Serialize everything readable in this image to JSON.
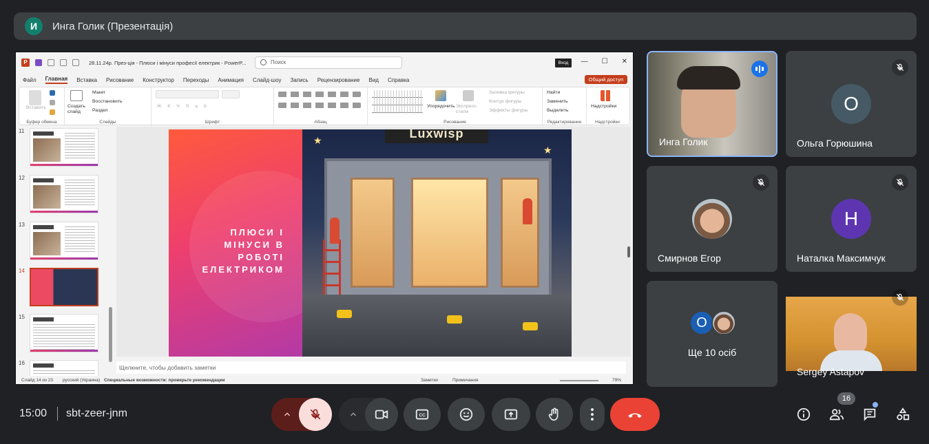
{
  "presenter_bar": {
    "avatar_letter": "И",
    "title": "Инга Голик (Презентація)"
  },
  "powerpoint": {
    "file_title": "28.11.24р. През-ція - Плюси і мінуси професії електрик - PowerP...",
    "search_placeholder": "Поиск",
    "login_label": "Вход",
    "share_label": "Общий доступ",
    "tabs": [
      "Файл",
      "Главная",
      "Вставка",
      "Рисование",
      "Конструктор",
      "Переходы",
      "Анимация",
      "Слайд-шоу",
      "Запись",
      "Рецензирование",
      "Вид",
      "Справка"
    ],
    "active_tab": "Главная",
    "ribbon": {
      "paste": "Вставить",
      "clipboard_group": "Буфер обмена",
      "new_slide": "Создать слайд",
      "layout": "Макет",
      "reset": "Восстановить",
      "section": "Раздел",
      "slides_group": "Слайды",
      "font_group": "Шрифт",
      "paragraph_group": "Абзац",
      "arrange": "Упорядочить",
      "quick_styles": "Экспресс-стили",
      "shape_fill": "Заливка фигуры",
      "shape_outline": "Контур фигуры",
      "shape_effects": "Эффекты фигуры",
      "drawing_group": "Рисование",
      "find": "Найти",
      "replace": "Заменить",
      "select": "Выделить",
      "editing_group": "Редактирование",
      "addins": "Надстройки",
      "addins_group": "Надстройки"
    },
    "slide_numbers": [
      "11",
      "12",
      "13",
      "14",
      "15",
      "16"
    ],
    "selected_slide": "14",
    "slide": {
      "headline": "ПЛЮСИ І МІНУСИ В РОБОТІ ЕЛЕКТРИКОМ",
      "sign_text": "Luxwisp"
    },
    "notes_placeholder": "Щелкните, чтобы добавить заметки",
    "status": {
      "slide_count": "Слайд 14 из 23",
      "language": "русский (Украина)",
      "accessibility": "Специальные возможности: проверьте рекомендации",
      "notes": "Заметки",
      "comments": "Примечания",
      "zoom": "79%"
    }
  },
  "participants": [
    {
      "name": "Инга Голик",
      "type": "video",
      "speaking": true
    },
    {
      "name": "Ольга Горюшина",
      "type": "letter",
      "letter": "О",
      "color": "#455a64",
      "muted": true
    },
    {
      "name": "Смирнов Егор",
      "type": "photo",
      "muted": true
    },
    {
      "name": "Наталка Максимчук",
      "type": "letter",
      "letter": "Н",
      "color": "#5e35b1",
      "muted": true
    },
    {
      "name": "Ще 10 осіб",
      "type": "group",
      "letter": "О"
    },
    {
      "name": "Sergey Astapov",
      "type": "video",
      "muted": true
    }
  ],
  "bottom_bar": {
    "time": "15:00",
    "meeting_code": "sbt-zeer-jnm",
    "participants_count": "16",
    "end_call_color": "#ea4335",
    "mic_muted_color": "#f9dedc"
  }
}
